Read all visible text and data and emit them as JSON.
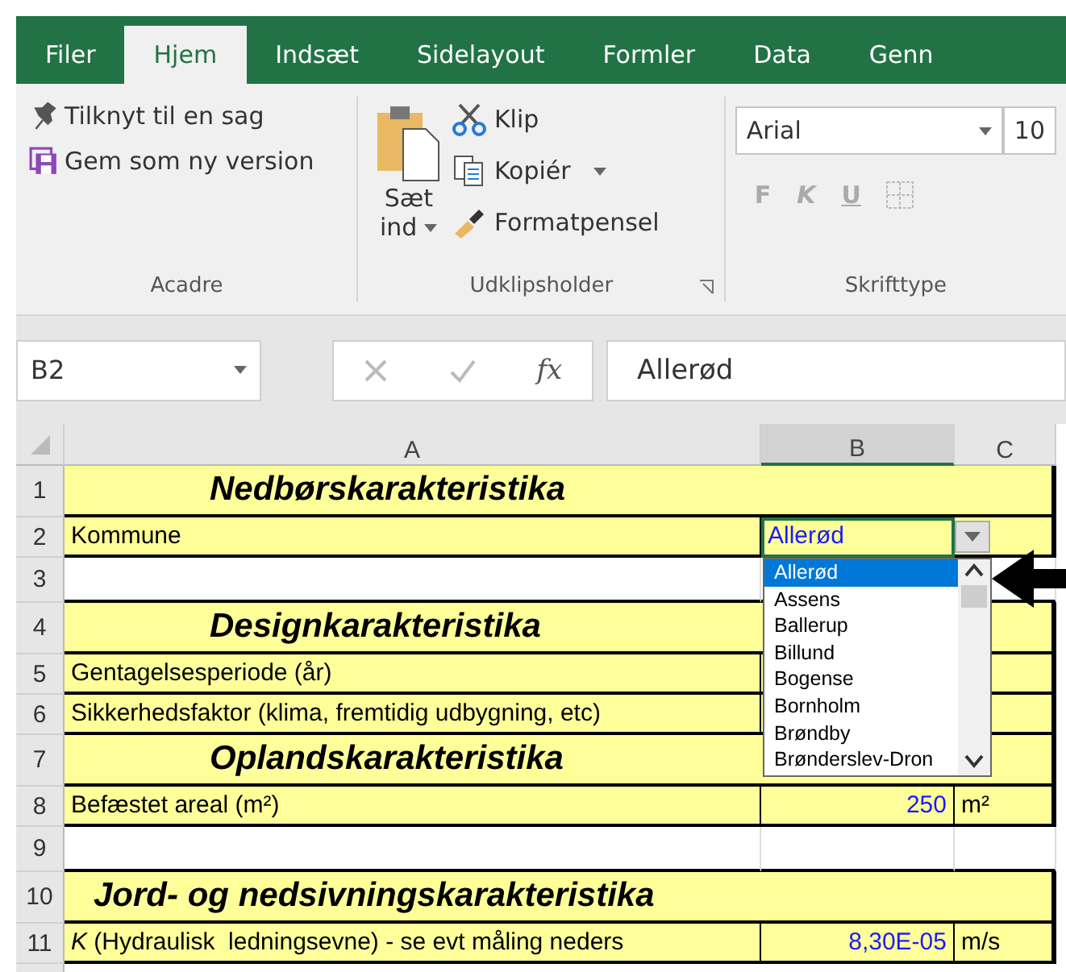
{
  "tabs": [
    {
      "label": "Filer",
      "selected": false
    },
    {
      "label": "Hjem",
      "selected": true
    },
    {
      "label": "Indsæt",
      "selected": false
    },
    {
      "label": "Sidelayout",
      "selected": false
    },
    {
      "label": "Formler",
      "selected": false
    },
    {
      "label": "Data",
      "selected": false
    },
    {
      "label": "Genn",
      "selected": false
    }
  ],
  "ribbon": {
    "acadre": {
      "items": [
        "Tilknyt til en sag",
        "Gem som ny version"
      ],
      "label": "Acadre"
    },
    "clipboard": {
      "paste": "Sæt ind",
      "items": [
        {
          "label": "Klip",
          "has_menu": false
        },
        {
          "label": "Kopiér",
          "has_menu": true
        },
        {
          "label": "Formatpensel",
          "has_menu": false
        }
      ],
      "label": "Udklipsholder"
    },
    "font": {
      "font_name": "Arial",
      "font_size": "10",
      "styles": [
        {
          "label": "F",
          "disabled": true
        },
        {
          "label": "K",
          "disabled": true
        },
        {
          "label": "U",
          "disabled": true
        }
      ],
      "label": "Skrifttype"
    }
  },
  "formula_bar": {
    "name_box": "B2",
    "function_symbol": "fx",
    "formula": "Allerød"
  },
  "columns": [
    {
      "label": "A",
      "selected": false
    },
    {
      "label": "B",
      "selected": true
    },
    {
      "label": "C",
      "selected": false
    }
  ],
  "rows": [
    {
      "number": "1",
      "kind": "title",
      "title": "Nedbørskarakteristika"
    },
    {
      "number": "2",
      "kind": "field",
      "label": "Kommune",
      "value": "Allerød",
      "active": true
    },
    {
      "number": "3",
      "kind": "blank"
    },
    {
      "number": "4",
      "kind": "title",
      "title": "Designkarakteristika"
    },
    {
      "number": "5",
      "kind": "field",
      "label": "Gentagelsesperiode (år)",
      "active": false
    },
    {
      "number": "6",
      "kind": "field",
      "label": "Sikkerhedsfaktor (klima, fremtidig udbygning, etc)",
      "active": false
    },
    {
      "number": "7",
      "kind": "title",
      "title": "Oplandskarakteristika"
    },
    {
      "number": "8",
      "kind": "field",
      "label": "Befæstet areal (m²)",
      "value": "250",
      "unit": "m²",
      "active": false
    },
    {
      "number": "9",
      "kind": "blank"
    },
    {
      "number": "10",
      "kind": "title",
      "title": "Jord- og nedsivningskarakteristika"
    },
    {
      "number": "11",
      "kind": "field",
      "label": "*K* (Hydraulisk  ledningsevne) - se evt måling neders",
      "value": "8,30E-05",
      "unit": "m/s",
      "active": false
    }
  ],
  "dropdown": {
    "items": [
      {
        "label": "Allerød",
        "selected": true
      },
      {
        "label": "Assens",
        "selected": false
      },
      {
        "label": "Ballerup",
        "selected": false
      },
      {
        "label": "Billund",
        "selected": false
      },
      {
        "label": "Bogense",
        "selected": false
      },
      {
        "label": "Bornholm",
        "selected": false
      },
      {
        "label": "Brøndby",
        "selected": false
      },
      {
        "label": "Brønderslev-Dron",
        "selected": false
      }
    ]
  }
}
